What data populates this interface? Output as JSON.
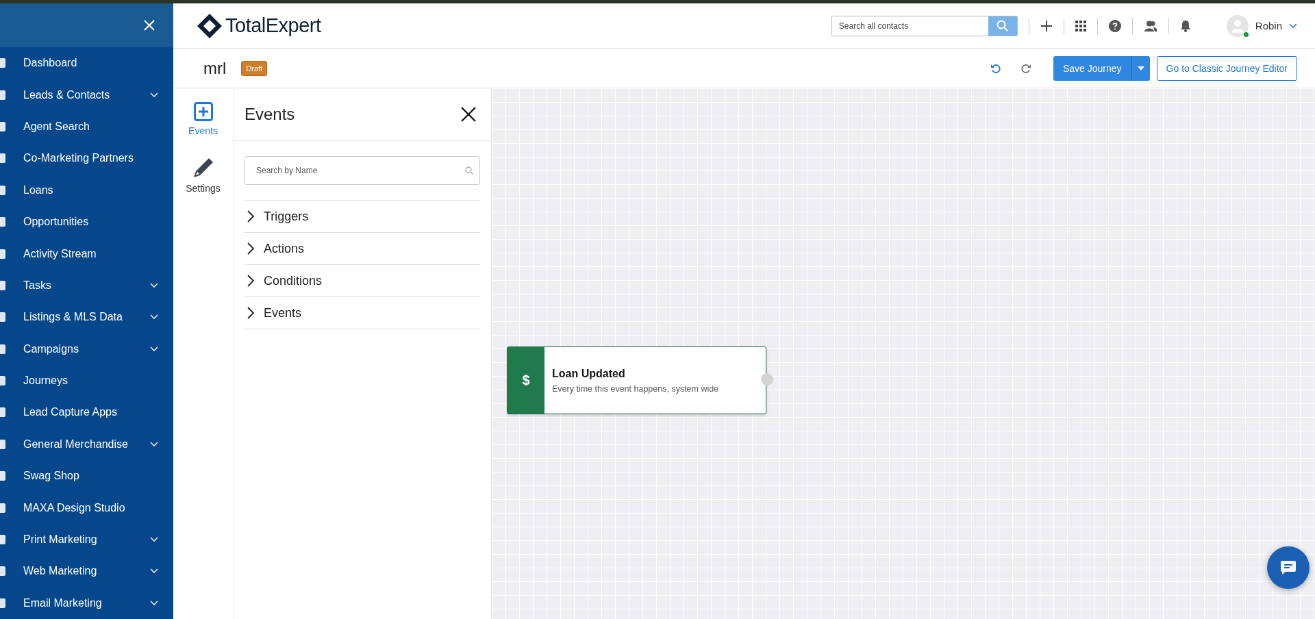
{
  "sidebar": {
    "items": [
      {
        "label": "Dashboard",
        "has_submenu": false
      },
      {
        "label": "Leads & Contacts",
        "has_submenu": true
      },
      {
        "label": "Agent Search",
        "has_submenu": false
      },
      {
        "label": "Co-Marketing Partners",
        "has_submenu": false
      },
      {
        "label": "Loans",
        "has_submenu": false
      },
      {
        "label": "Opportunities",
        "has_submenu": false
      },
      {
        "label": "Activity Stream",
        "has_submenu": false
      },
      {
        "label": "Tasks",
        "has_submenu": true
      },
      {
        "label": "Listings & MLS Data",
        "has_submenu": true
      },
      {
        "label": "Campaigns",
        "has_submenu": true
      },
      {
        "label": "Journeys",
        "has_submenu": false
      },
      {
        "label": "Lead Capture Apps",
        "has_submenu": false
      },
      {
        "label": "General Merchandise",
        "has_submenu": true
      },
      {
        "label": "Swag Shop",
        "has_submenu": false
      },
      {
        "label": "MAXA Design Studio",
        "has_submenu": false
      },
      {
        "label": "Print Marketing",
        "has_submenu": true
      },
      {
        "label": "Web Marketing",
        "has_submenu": true
      },
      {
        "label": "Email Marketing",
        "has_submenu": true
      }
    ]
  },
  "header": {
    "logo": "TotalExpert",
    "search": {
      "placeholder": "Search all contacts"
    },
    "user": {
      "name": "Robin",
      "online": true
    }
  },
  "toolbar": {
    "journey_name": "mrl",
    "status_badge": "Draft",
    "undo": {
      "disabled": false
    },
    "redo": {
      "disabled": true
    },
    "save_button": "Save Journey",
    "classic_button": "Go to Classic Journey Editor"
  },
  "rail": {
    "tabs": [
      {
        "label": "Events",
        "selected": true
      },
      {
        "label": "Settings",
        "selected": false
      }
    ]
  },
  "panel": {
    "title": "Events",
    "search": {
      "placeholder": "Search by Name"
    },
    "sections": [
      {
        "label": "Triggers",
        "expanded": false
      },
      {
        "label": "Actions",
        "expanded": false
      },
      {
        "label": "Conditions",
        "expanded": false
      },
      {
        "label": "Events",
        "expanded": false
      }
    ]
  },
  "canvas": {
    "nodes": [
      {
        "symbol": "$",
        "title": "Loan Updated",
        "description": "Every time this event happens, system wide"
      }
    ]
  }
}
